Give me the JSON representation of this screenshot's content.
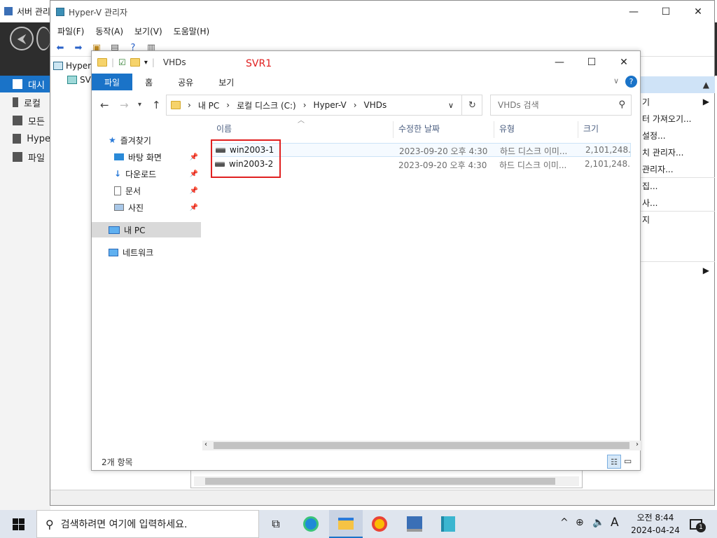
{
  "server_manager": {
    "title": "서버 관리",
    "sidebar": [
      "대시",
      "로컬",
      "모든",
      "Hype",
      "파일"
    ],
    "back_icon": "back-arrow-icon",
    "forward_icon": "forward-arrow-icon"
  },
  "hyperv": {
    "title": "Hyper-V 관리자",
    "menu": [
      "파일(F)",
      "동작(A)",
      "보기(V)",
      "도움말(H)"
    ],
    "tree": [
      "Hyper",
      "SV"
    ],
    "actions": [
      "기",
      "터 가져오기...",
      "설정...",
      "치 관리자...",
      "관리자...",
      "집...",
      "사...",
      "지"
    ]
  },
  "explorer": {
    "title": "VHDs",
    "annotation": "SVR1",
    "ribbon_tabs": [
      "파일",
      "홈",
      "공유",
      "보기"
    ],
    "breadcrumb": [
      "내 PC",
      "로컬 디스크 (C:)",
      "Hyper-V",
      "VHDs"
    ],
    "search_placeholder": "VHDs 검색",
    "nav": {
      "quick_access": "즐겨찾기",
      "desktop": "바탕 화면",
      "downloads": "다운로드",
      "documents": "문서",
      "pictures": "사진",
      "this_pc": "내 PC",
      "network": "네트워크"
    },
    "columns": [
      "이름",
      "수정한 날짜",
      "유형",
      "크기"
    ],
    "files": [
      {
        "name": "win2003-1",
        "modified": "2023-09-20 오후 4:30",
        "type": "하드 디스크 이미...",
        "size": "2,101,248..."
      },
      {
        "name": "win2003-2",
        "modified": "2023-09-20 오후 4:30",
        "type": "하드 디스크 이미...",
        "size": "2,101,248..."
      }
    ],
    "status": "2개 항목"
  },
  "taskbar": {
    "search_text": "검색하려면 여기에 입력하세요.",
    "time": "오전 8:44",
    "date": "2024-04-24",
    "ime": "A",
    "notification_count": "1"
  }
}
